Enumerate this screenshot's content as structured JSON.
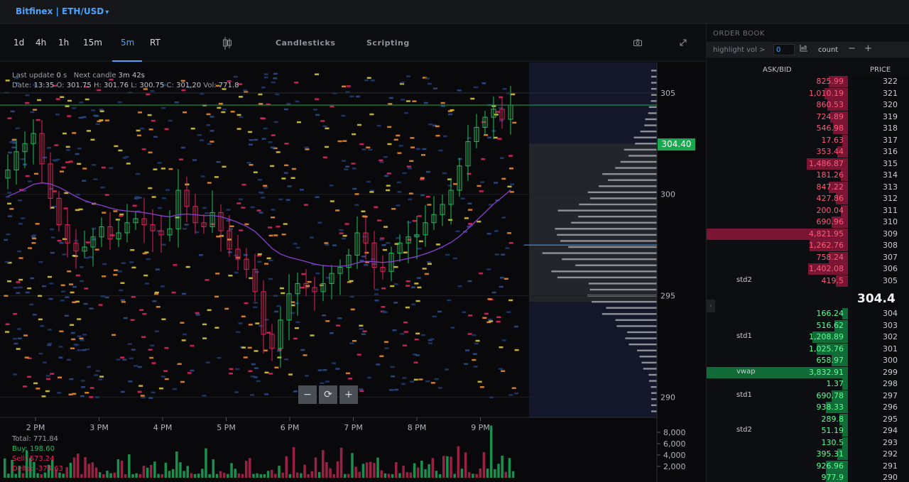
{
  "header": {
    "market": "Bitfinex | ETH/USD"
  },
  "toolbar": {
    "timeframes": [
      "1d",
      "4h",
      "1h",
      "15m",
      "5m",
      "RT"
    ],
    "active_timeframe": "5m",
    "candlesticks_label": "Candlesticks",
    "scripting_label": "Scripting"
  },
  "chart": {
    "last_update_label": "Last update",
    "last_update_value": "0",
    "last_update_unit": "s",
    "next_candle_label": "Next candle",
    "next_candle_value": "3m 42s",
    "date_label": "Date:",
    "date_value": "13:35",
    "open_label": "O:",
    "open_value": "301.75",
    "high_label": "H:",
    "high_value": "301.76",
    "low_label": "L:",
    "low_value": "300.75",
    "close_label": "C:",
    "close_value": "301.20",
    "vol_label": "Vol:",
    "vol_value": "771.8",
    "current_price_tag": "304.40",
    "volume_total_label": "Total:",
    "volume_total": "771.84",
    "volume_buy_label": "Buy:",
    "volume_buy": "198.60",
    "volume_sell_label": "Sell:",
    "volume_sell": "573.24",
    "volume_delta_label": "Delta:",
    "volume_delta": "-374.63",
    "colors": {
      "up": "#1fbf5e",
      "down": "#e0245e",
      "vwap": "#8a3fd1",
      "price_line": "#18a84f"
    }
  },
  "chart_data": {
    "type": "candlestick",
    "x_ticks": [
      "2 PM",
      "3 PM",
      "4 PM",
      "5 PM",
      "6 PM",
      "7 PM",
      "8 PM",
      "9 PM"
    ],
    "y_ticks": [
      305,
      300,
      295,
      290
    ],
    "volume_ticks": [
      "8,000",
      "6,000",
      "4,000",
      "2,000"
    ],
    "ylim": [
      289,
      306.5
    ],
    "close_series": [
      301.2,
      302.1,
      302.5,
      303.0,
      301.5,
      299.8,
      298.5,
      297.6,
      297.2,
      297.4,
      297.9,
      298.4,
      297.8,
      298.1,
      298.6,
      298.8,
      298.5,
      298.2,
      298.0,
      298.3,
      300.2,
      299.4,
      298.6,
      298.4,
      299.1,
      298.2,
      297.3,
      296.8,
      296.3,
      295.2,
      293.1,
      292.4,
      293.8,
      295.1,
      295.6,
      295.4,
      295.2,
      295.6,
      296.1,
      296.4,
      297.0,
      298.1,
      297.6,
      296.4,
      296.2,
      297.1,
      297.6,
      297.9,
      298.0,
      298.6,
      299.0,
      299.5,
      300.2,
      301.4,
      302.6,
      303.3,
      303.8,
      304.2,
      303.7,
      304.4
    ],
    "vwap_label": "vwap"
  },
  "order_book": {
    "title": "ORDER BOOK",
    "highlight_label": "highlight vol >",
    "highlight_value": "0",
    "count_label": "count",
    "col_askbid": "ASK/BID",
    "col_price": "PRICE",
    "current_price": "304.4",
    "asks": [
      {
        "price": "322",
        "amount": "825.99",
        "w": 0.14
      },
      {
        "price": "321",
        "amount": "1,010.19",
        "w": 0.17
      },
      {
        "price": "320",
        "amount": "860.53",
        "w": 0.15
      },
      {
        "price": "319",
        "amount": "724.89",
        "w": 0.13
      },
      {
        "price": "318",
        "amount": "546.98",
        "w": 0.11
      },
      {
        "price": "317",
        "amount": "17.63",
        "w": 0.02
      },
      {
        "price": "316",
        "amount": "353.44",
        "w": 0.08
      },
      {
        "price": "315",
        "amount": "1,486.87",
        "w": 0.3
      },
      {
        "price": "314",
        "amount": "181.26",
        "w": 0.05
      },
      {
        "price": "313",
        "amount": "847.22",
        "w": 0.14
      },
      {
        "price": "312",
        "amount": "427.86",
        "w": 0.09
      },
      {
        "price": "311",
        "amount": "200.04",
        "w": 0.05
      },
      {
        "price": "310",
        "amount": "690.96",
        "w": 0.12
      },
      {
        "price": "309",
        "amount": "4,821.95",
        "w": 1.0
      },
      {
        "price": "308",
        "amount": "1,262.76",
        "w": 0.28
      },
      {
        "price": "307",
        "amount": "758.24",
        "w": 0.14
      },
      {
        "price": "306",
        "amount": "1,402.08",
        "w": 0.29
      },
      {
        "price": "305",
        "amount": "419.5",
        "w": 0.09,
        "tag": "std2"
      }
    ],
    "bids": [
      {
        "price": "304",
        "amount": "166.24",
        "w": 0.04
      },
      {
        "price": "303",
        "amount": "516.62",
        "w": 0.1
      },
      {
        "price": "302",
        "amount": "1,208.89",
        "w": 0.26,
        "tag": "std1"
      },
      {
        "price": "301",
        "amount": "1,025.76",
        "w": 0.23
      },
      {
        "price": "300",
        "amount": "658.97",
        "w": 0.12
      },
      {
        "price": "299",
        "amount": "3,832.91",
        "w": 1.0,
        "tag": "vwap"
      },
      {
        "price": "298",
        "amount": "1.37",
        "w": 0.01
      },
      {
        "price": "297",
        "amount": "690.78",
        "w": 0.12,
        "tag": "std1"
      },
      {
        "price": "296",
        "amount": "938.33",
        "w": 0.16
      },
      {
        "price": "295",
        "amount": "289.8",
        "w": 0.06
      },
      {
        "price": "294",
        "amount": "51.19",
        "w": 0.02,
        "tag": "std2"
      },
      {
        "price": "293",
        "amount": "130.5",
        "w": 0.03
      },
      {
        "price": "292",
        "amount": "395.31",
        "w": 0.08
      },
      {
        "price": "291",
        "amount": "926.96",
        "w": 0.16
      },
      {
        "price": "290",
        "amount": "977.9",
        "w": 0.16
      }
    ]
  }
}
